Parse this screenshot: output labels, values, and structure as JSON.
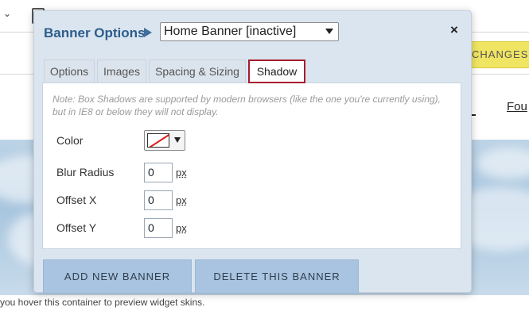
{
  "background": {
    "changes_button": "CHANGES",
    "nav_link": "Fou",
    "hint_text": "you hover this container to preview widget skins."
  },
  "dialog": {
    "title": "Banner Options",
    "banner_select": {
      "value": "Home Banner [inactive]"
    },
    "close_label": "×",
    "tabs": [
      {
        "label": "Options"
      },
      {
        "label": "Images"
      },
      {
        "label": "Spacing & Sizing"
      },
      {
        "label": "Shadow",
        "active": true
      }
    ],
    "note": "Note: Box Shadows are supported by modern browsers (like the one you're currently using), but in IE8 or below they will not display.",
    "fields": {
      "color": {
        "label": "Color",
        "value": "none"
      },
      "blur_radius": {
        "label": "Blur Radius",
        "value": "0",
        "unit": "px"
      },
      "offset_x": {
        "label": "Offset X",
        "value": "0",
        "unit": "px"
      },
      "offset_y": {
        "label": "Offset Y",
        "value": "0",
        "unit": "px"
      }
    },
    "buttons": {
      "add": "ADD NEW BANNER",
      "delete": "DELETE THIS BANNER"
    }
  },
  "colors": {
    "dialog_bg": "#dae5f0",
    "title_color": "#2d5d8a",
    "active_tab_border": "#a51d2d",
    "button_bg": "#a9c4e0",
    "changes_button_bg": "#f0e563"
  },
  "icons": [
    "chevron-down-icon",
    "file-icon",
    "title-arrow-icon",
    "select-caret-icon",
    "close-icon",
    "no-color-swatch-icon",
    "picker-caret-icon"
  ]
}
